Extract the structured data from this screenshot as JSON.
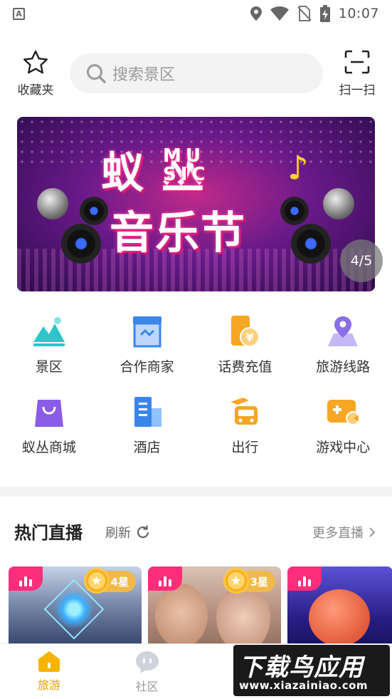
{
  "status_bar": {
    "left_icon": "A",
    "time": "10:07",
    "icons": [
      "location-icon",
      "wifi-icon",
      "no-sim-icon",
      "battery-charging-icon"
    ]
  },
  "header": {
    "favorites_label": "收藏夹",
    "search_placeholder": "搜索景区",
    "scan_label": "扫一扫"
  },
  "banner": {
    "title_line1": "蚁 丛",
    "music_text": "MU SIC",
    "title_line2": "音乐节",
    "page_indicator": "4/5"
  },
  "grid": {
    "items": [
      {
        "label": "景区",
        "icon": "mountain-icon",
        "color": "#2ec5c9"
      },
      {
        "label": "合作商家",
        "icon": "store-icon",
        "color": "#3a86e8"
      },
      {
        "label": "话费充值",
        "icon": "phone-recharge-icon",
        "color": "#f5a623"
      },
      {
        "label": "旅游线路",
        "icon": "map-pin-icon",
        "color": "#8a6ee8"
      },
      {
        "label": "蚁丛商城",
        "icon": "shopping-bag-icon",
        "color": "#8a5ce8"
      },
      {
        "label": "酒店",
        "icon": "hotel-icon",
        "color": "#3a86e8"
      },
      {
        "label": "出行",
        "icon": "travel-bus-icon",
        "color": "#f5a623"
      },
      {
        "label": "游戏中心",
        "icon": "game-icon",
        "color": "#f5a623"
      }
    ]
  },
  "live": {
    "title": "热门直播",
    "refresh_label": "刷新",
    "more_label": "更多直播",
    "cards": [
      {
        "stars": "4星"
      },
      {
        "stars": "3星"
      },
      {
        "stars": ""
      }
    ]
  },
  "tabbar": {
    "tabs": [
      {
        "label": "旅游",
        "active": true
      },
      {
        "label": "社区",
        "active": false
      },
      {
        "label": "",
        "active": false
      },
      {
        "label": "",
        "active": false
      }
    ]
  },
  "watermark": {
    "title": "下载鸟应用",
    "url": "www.xiazainiao.com"
  },
  "colors": {
    "accent": "#f5b400",
    "live_tag": "#ff2e7a",
    "star_badge": "#f1b94a"
  }
}
